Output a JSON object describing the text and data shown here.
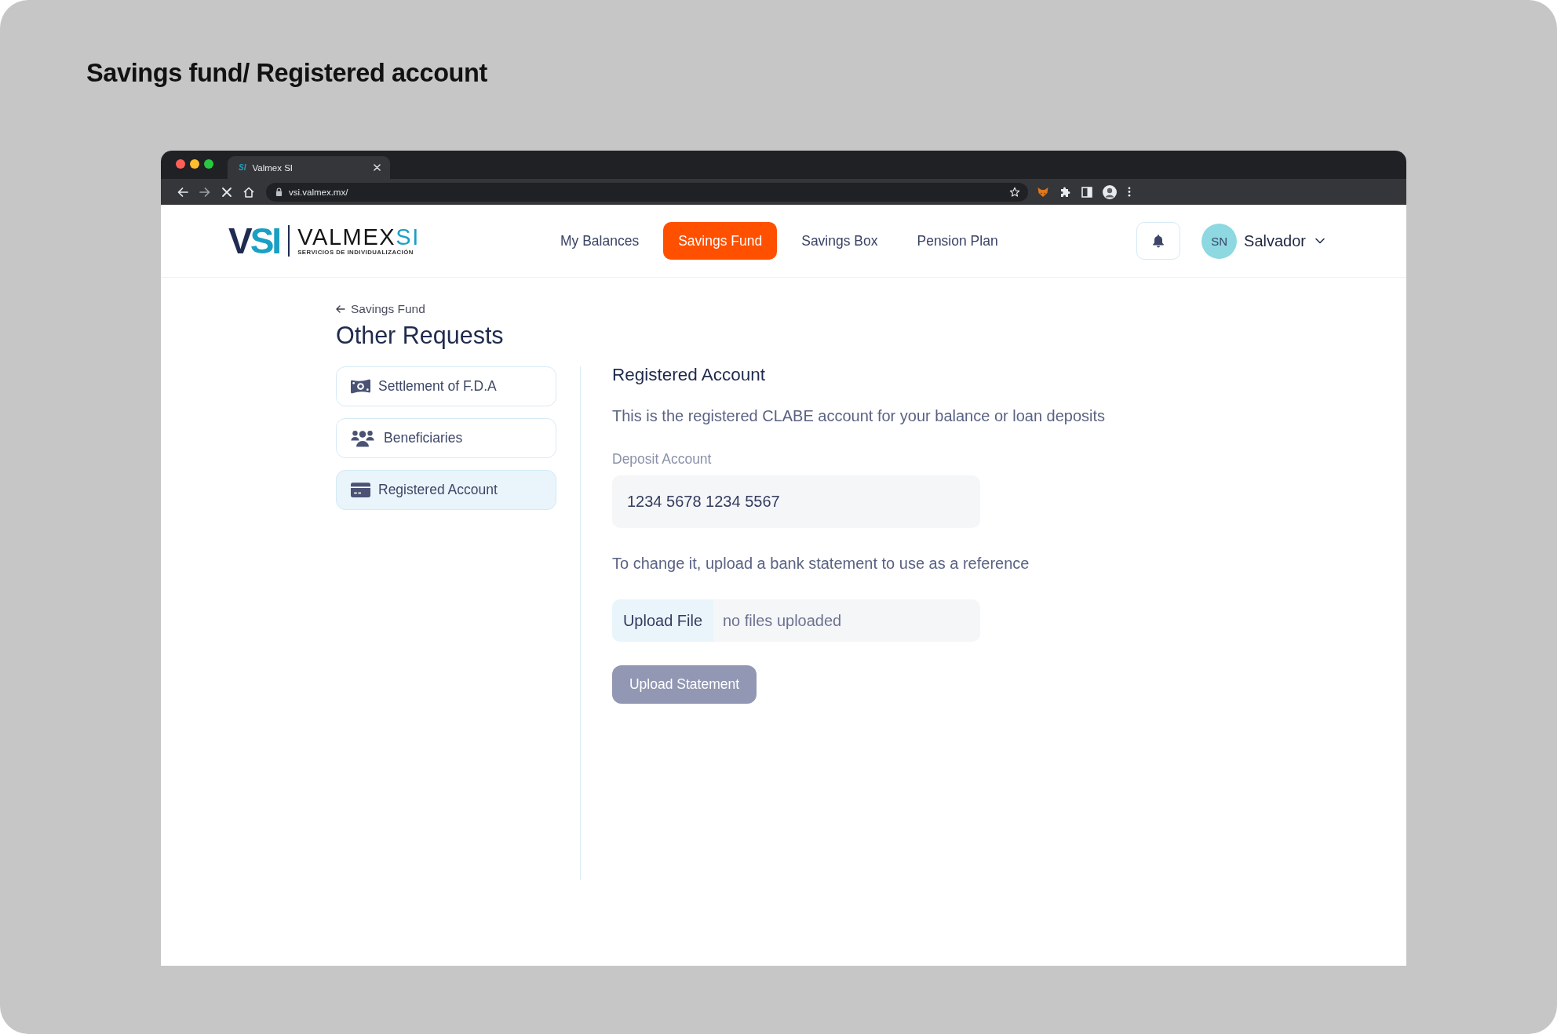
{
  "page_title": "Savings fund/ Registered account",
  "browser": {
    "tab": {
      "favicon": "SI",
      "title": "Valmex SI"
    },
    "url": "vsi.valmex.mx/"
  },
  "header": {
    "logo": {
      "mark": "V",
      "mark_accent": "SI",
      "wordmark": "VALMEX",
      "wordmark_accent": "SI",
      "tagline": "SERVICIOS DE INDIVIDUALIZACIÓN"
    },
    "nav": [
      {
        "label": "My Balances",
        "selected": false
      },
      {
        "label": "Savings Fund",
        "selected": true
      },
      {
        "label": "Savings Box",
        "selected": false
      },
      {
        "label": "Pension Plan",
        "selected": false
      }
    ],
    "user": {
      "initials": "SN",
      "name": "Salvador"
    }
  },
  "back_link": "Savings Fund",
  "heading": "Other Requests",
  "sidebar": {
    "items": [
      {
        "label": "Settlement of F.D.A",
        "selected": false
      },
      {
        "label": "Beneficiaries",
        "selected": false
      },
      {
        "label": "Registered Account",
        "selected": true
      }
    ]
  },
  "panel": {
    "title": "Registered Account",
    "description": "This is the registered CLABE account for your balance or loan deposits",
    "deposit_label": "Deposit Account",
    "deposit_value": "1234 5678 1234 5567",
    "change_note": "To change it, upload a bank statement to use as a reference",
    "upload_button": "Upload File",
    "file_status": "no files uploaded",
    "submit": {
      "label": "Upload Statement",
      "disabled": true
    }
  }
}
